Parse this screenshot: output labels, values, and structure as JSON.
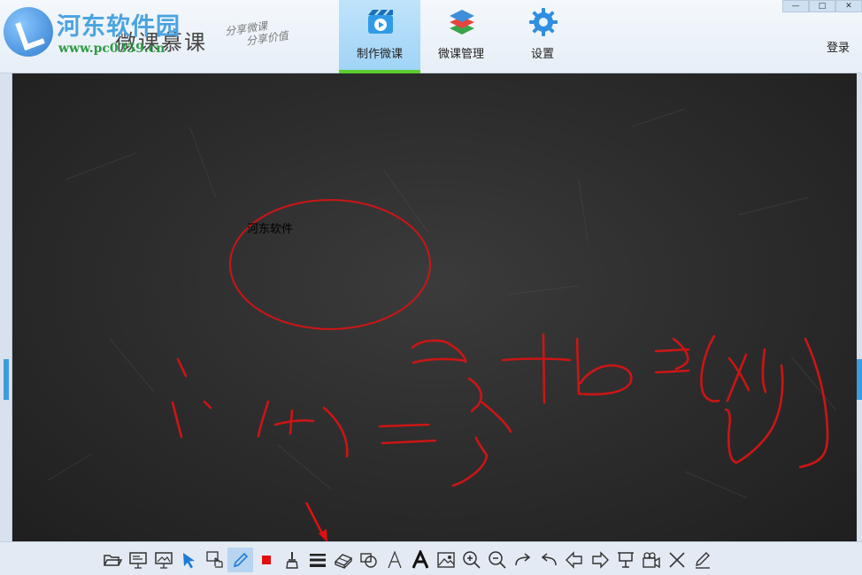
{
  "header": {
    "watermark_title": "河东软件园",
    "watermark_url": "www.pc0359.cn",
    "app_title": "微课慕课",
    "slogan_line1": "分享微课",
    "slogan_line2": "分享价值",
    "tabs": [
      {
        "label": "制作微课",
        "icon": "video-icon",
        "active": true
      },
      {
        "label": "微课管理",
        "icon": "layers-icon",
        "active": false
      },
      {
        "label": "设置",
        "icon": "gear-icon",
        "active": false
      }
    ],
    "window_controls": [
      "minimize",
      "maximize",
      "close"
    ],
    "login_label": "登录"
  },
  "board": {
    "text_label": "河东软件",
    "ink_color": "#cc1515",
    "background": "#2c2c2c"
  },
  "toolbar": {
    "active_tool": "pen",
    "annotation_target": "eraser",
    "tools": [
      "open-folder-icon",
      "presentation-icon",
      "image-board-icon",
      "select-arrow-icon",
      "touch-select-icon",
      "pen-icon",
      "color-swatch-icon",
      "brush-icon",
      "line-width-icon",
      "eraser-icon",
      "shape-icon",
      "text-thin-icon",
      "text-bold-icon",
      "insert-image-icon",
      "zoom-in-icon",
      "zoom-out-icon",
      "redo-icon",
      "undo-icon",
      "previous-icon",
      "next-icon",
      "projector-icon",
      "camera-icon",
      "clear-icon",
      "edit-icon"
    ]
  }
}
